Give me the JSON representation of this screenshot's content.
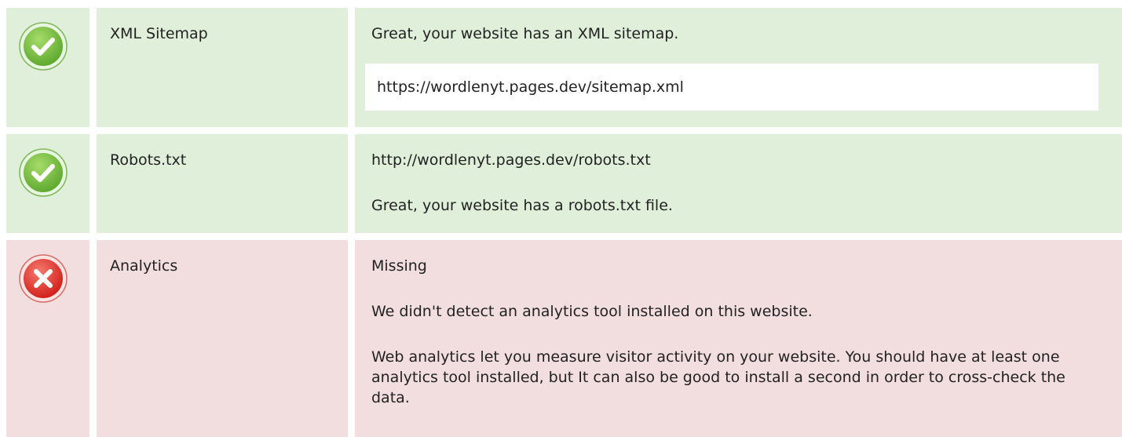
{
  "rows": [
    {
      "status": "pass",
      "icon": "check-circle-icon",
      "name": "XML Sitemap",
      "message": "Great, your website has an XML sitemap.",
      "url": "https://wordlenyt.pages.dev/sitemap.xml"
    },
    {
      "status": "pass",
      "icon": "check-circle-icon",
      "name": "Robots.txt",
      "url": "http://wordlenyt.pages.dev/robots.txt",
      "message": "Great, your website has a robots.txt file."
    },
    {
      "status": "fail",
      "icon": "x-circle-icon",
      "name": "Analytics",
      "status_text": "Missing",
      "message": "We didn't detect an analytics tool installed on this website.",
      "detail": "Web analytics let you measure visitor activity on your website. You should have at least one analytics tool installed, but It can also be good to install a second in order to cross-check the data."
    }
  ],
  "colors": {
    "pass_bg": "#e0efda",
    "fail_bg": "#f2dede",
    "pass_icon": "#7cc142",
    "fail_icon": "#e3342f"
  }
}
